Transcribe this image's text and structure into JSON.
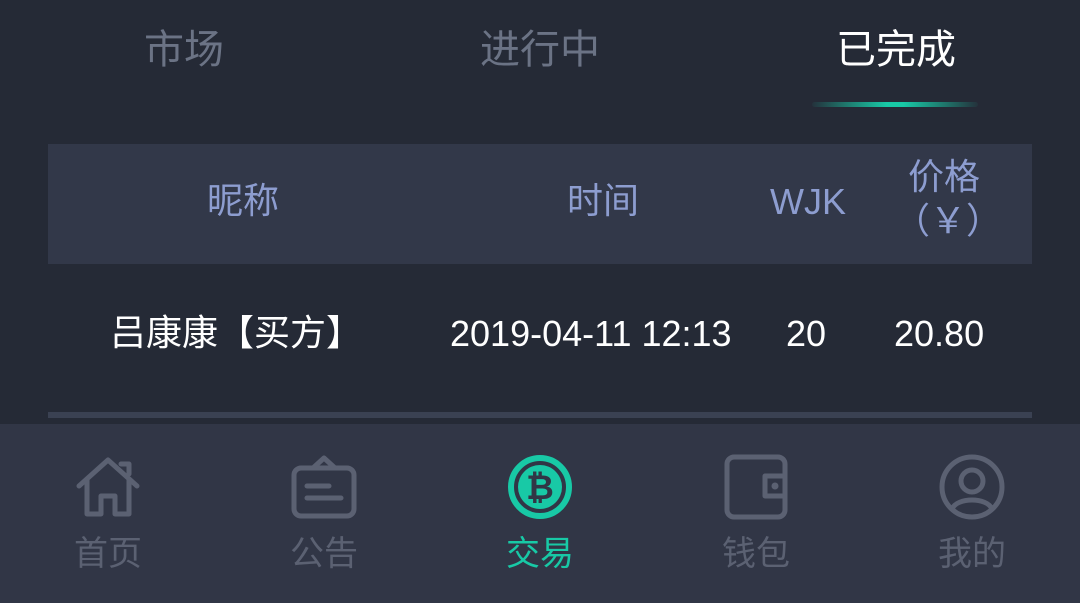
{
  "tabs": [
    {
      "label": "市场",
      "active": false
    },
    {
      "label": "进行中",
      "active": false
    },
    {
      "label": "已完成",
      "active": true
    }
  ],
  "table": {
    "headers": {
      "nickname": "昵称",
      "time": "时间",
      "wjk": "WJK",
      "price_line1": "价格",
      "price_line2": "（￥）"
    },
    "rows": [
      {
        "nickname": "吕康康【买方】",
        "time": "2019-04-11 12:13",
        "wjk": "20",
        "price": "20.80"
      }
    ]
  },
  "bottom_nav": [
    {
      "label": "首页",
      "icon": "home-icon",
      "active": false
    },
    {
      "label": "公告",
      "icon": "notice-icon",
      "active": false
    },
    {
      "label": "交易",
      "icon": "bitcoin-icon",
      "active": true
    },
    {
      "label": "钱包",
      "icon": "wallet-icon",
      "active": false
    },
    {
      "label": "我的",
      "icon": "user-icon",
      "active": false
    }
  ],
  "colors": {
    "background": "#252a36",
    "header_bg": "#323849",
    "nav_bg": "#313646",
    "accent": "#18c9a6",
    "inactive": "#5b6172",
    "header_text": "#8d9dd0"
  }
}
